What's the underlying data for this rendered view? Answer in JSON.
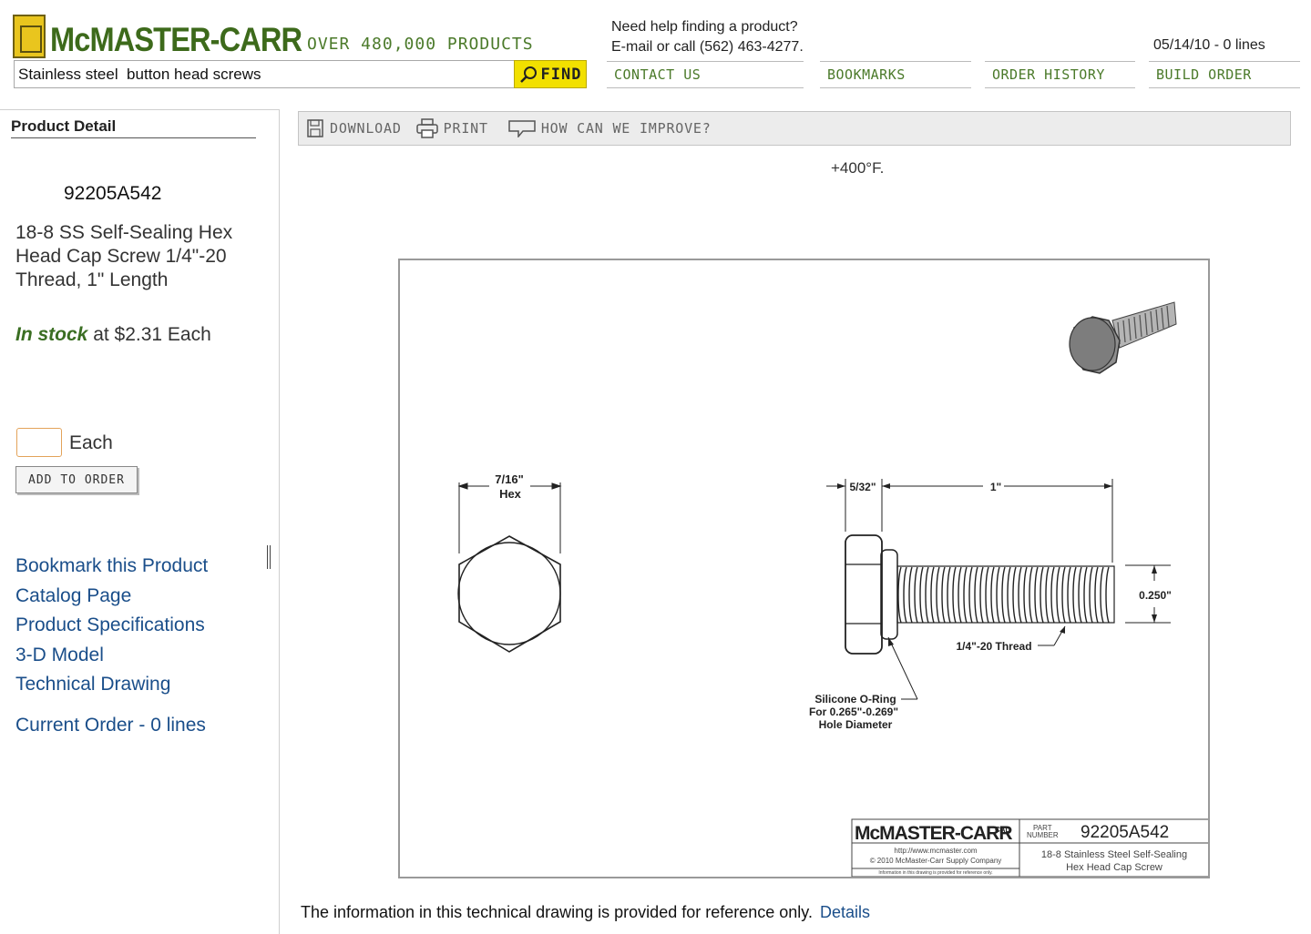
{
  "header": {
    "logo_text": "McMASTER-CARR",
    "tagline": "OVER 480,000 PRODUCTS",
    "help_line1": "Need help finding a product?",
    "help_line2": "E-mail or call (562) 463-4277.",
    "date_lines": "05/14/10 - 0 lines",
    "search_value": "Stainless steel  button head screws",
    "find_label": "FIND",
    "nav": [
      {
        "label": "CONTACT US"
      },
      {
        "label": "BOOKMARKS"
      },
      {
        "label": "ORDER HISTORY"
      },
      {
        "label": "BUILD ORDER"
      }
    ]
  },
  "left": {
    "title": "Product Detail",
    "part_number": "92205A542",
    "description": "18-8 SS Self-Sealing Hex Head Cap Screw 1/4\"-20 Thread, 1\" Length",
    "stock_label": "In stock",
    "price_text": " at $2.31 Each",
    "qty_unit": "Each",
    "add_button": "ADD TO ORDER",
    "links": [
      {
        "label": "Bookmark this Product"
      },
      {
        "label": "Catalog Page"
      },
      {
        "label": "Product Specifications"
      },
      {
        "label": "3-D Model"
      },
      {
        "label": "Technical Drawing"
      }
    ],
    "current_order": "Current Order - 0 lines"
  },
  "toolbar": {
    "download": "DOWNLOAD",
    "print": "PRINT",
    "improve": "HOW CAN WE IMPROVE?"
  },
  "cut_text": "+400°F.",
  "drawing": {
    "hex_dim": "7/16\"",
    "hex_label": "Hex",
    "head_dim": "5/32\"",
    "length_dim": "1\"",
    "dia_dim": "0.250\"",
    "thread_label": "1/4\"-20 Thread",
    "oring_line1": "Silicone O-Ring",
    "oring_line2": "For 0.265\"-0.269\"",
    "oring_line3": "Hole Diameter",
    "tb_logo": "McMASTER-CARR",
    "tb_cad": "CAD",
    "tb_part_label1": "PART",
    "tb_part_label2": "NUMBER",
    "tb_part_number": "92205A542",
    "tb_url": "http://www.mcmaster.com",
    "tb_copyright": "© 2010 McMaster-Carr Supply Company",
    "tb_disclaimer": "Information in this drawing is provided for reference only.",
    "tb_desc1": "18-8 Stainless Steel Self-Sealing",
    "tb_desc2": "Hex Head Cap Screw"
  },
  "footer": {
    "note": "The information in this technical drawing is provided for reference only.",
    "details": "Details"
  }
}
